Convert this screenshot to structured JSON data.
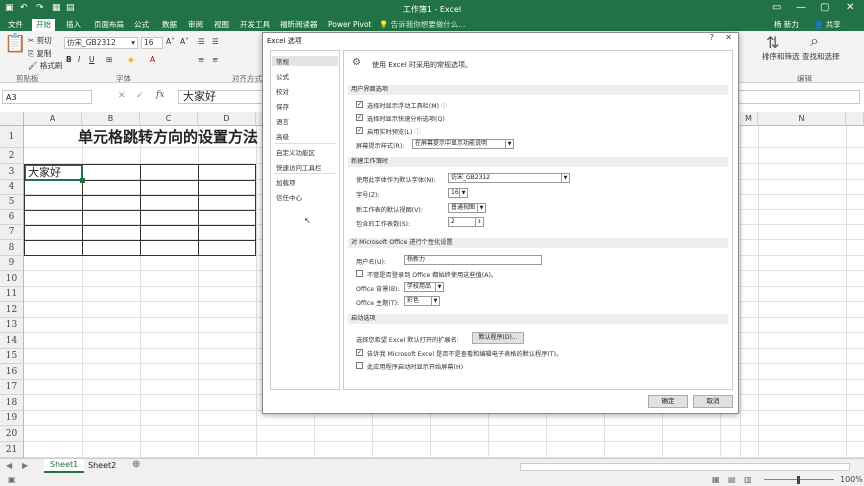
{
  "app": {
    "title": "工作簿1 - Excel",
    "user": "杨 新力",
    "tabs": [
      "文件",
      "开始",
      "插入",
      "页面布局",
      "公式",
      "数据",
      "审阅",
      "视图",
      "开发工具",
      "福昕阅读器",
      "Power Pivot"
    ],
    "tell_me": "告诉我你想要做什么...",
    "share": "共享"
  },
  "ribbon": {
    "clipboard": {
      "cut": "剪切",
      "copy": "复制",
      "format_painter": "格式刷",
      "group": "剪贴板"
    },
    "font": {
      "name": "仿宋_GB2312",
      "size": "16",
      "group": "字体"
    },
    "alignment_group": "对齐方式",
    "sort_filter": "排序和筛选",
    "find_select": "查找和选择",
    "editing_group": "编辑"
  },
  "formula_bar": {
    "name_box": "A3",
    "content": "大家好"
  },
  "sheet": {
    "columns": [
      "A",
      "B",
      "C",
      "D",
      "M",
      "N"
    ],
    "rows": [
      "1",
      "2",
      "3",
      "4",
      "5",
      "6",
      "7",
      "8",
      "9",
      "10",
      "11",
      "12",
      "13",
      "14",
      "15",
      "16",
      "17",
      "18",
      "19",
      "20",
      "21"
    ],
    "title_cell": "单元格跳转方向的设置方法",
    "a3_cell": "大家好"
  },
  "sheet_tabs": [
    "Sheet1",
    "Sheet2"
  ],
  "status": {
    "zoom": "100%"
  },
  "dialog": {
    "title": "Excel 选项",
    "nav": [
      "常规",
      "公式",
      "校对",
      "保存",
      "语言",
      "高级",
      "自定义功能区",
      "快速访问工具栏",
      "加载项",
      "信任中心"
    ],
    "intro": "使用 Excel 时采用的常规选项。",
    "sections": {
      "ui": "用户界面选项",
      "new_wb": "新建工作簿时",
      "personalize": "对 Microsoft Office 进行个性化设置",
      "startup": "启动选项"
    },
    "ui_options": [
      "选择时显示浮动工具栏(M)",
      "选择时显示快速分析选项(Q)",
      "启用实时预览(L)"
    ],
    "screentip_label": "屏幕提示样式(R):",
    "screentip_value": "在屏幕提示中显示功能说明",
    "font_label": "使用此字体作为默认字体(N):",
    "font_value": "仿宋_GB2312",
    "size_label": "字号(Z):",
    "size_value": "16",
    "view_label": "新工作表的默认视图(V):",
    "view_value": "普通视图",
    "sheets_label": "包含的工作表数(S):",
    "sheets_value": "2",
    "username_label": "用户名(U):",
    "username_value": "杨新力",
    "always_use": "不管是否登录到 Office 都始终使用这些值(A)。",
    "bg_label": "Office 背景(B):",
    "bg_value": "学校用品",
    "theme_label": "Office 主题(T):",
    "theme_value": "彩色",
    "ext_label": "选择您希望 Excel 默认打开的扩展名:",
    "default_programs": "默认程序(D)...",
    "tell_me_default": "告诉我 Microsoft Excel 是否不是查看和编辑电子表格的默认程序(T)。",
    "show_start": "此应用程序启动时显示开始屏幕(H)",
    "ok": "确定",
    "cancel": "取消"
  },
  "colors": {
    "excel_green": "#217346"
  }
}
